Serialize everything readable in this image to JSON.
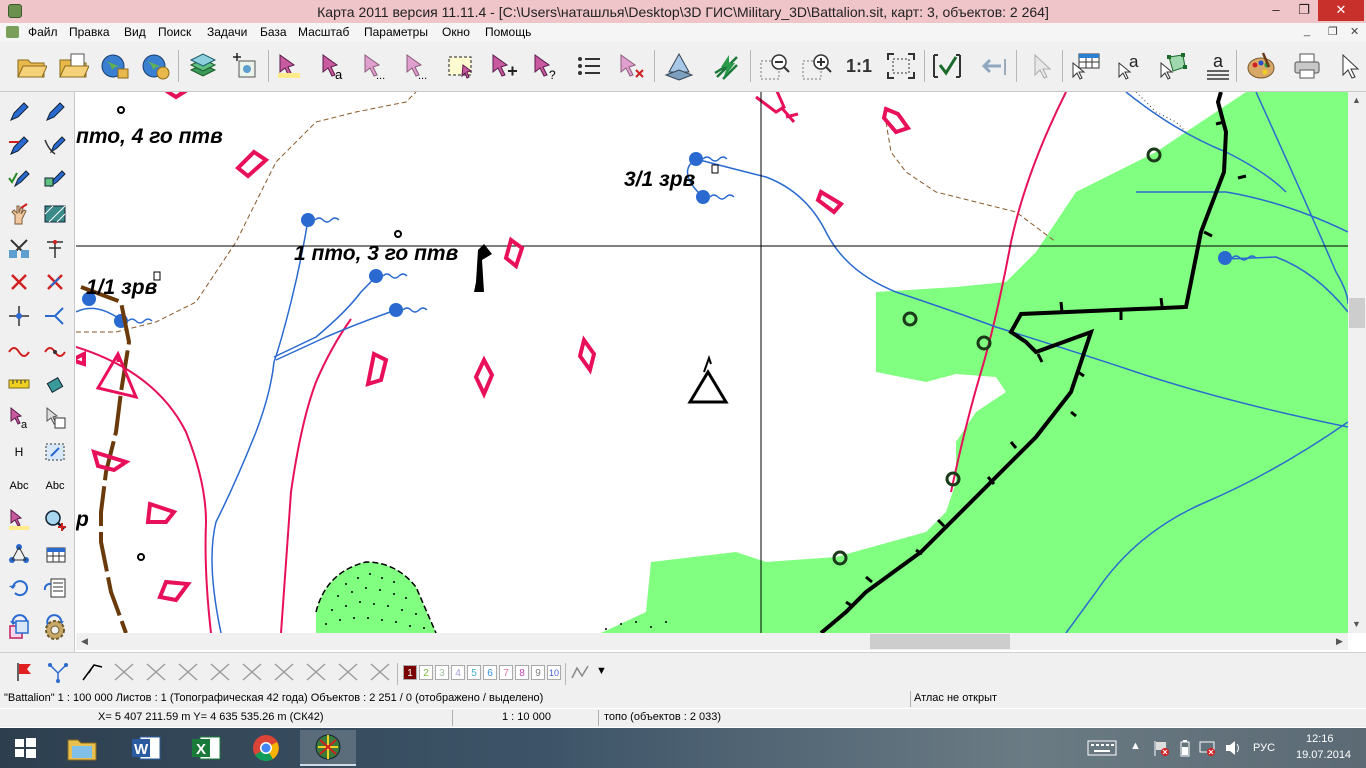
{
  "window": {
    "title": "Карта 2011 версия 11.11.4 - [C:\\Users\\наташлья\\Desktop\\3D ГИС\\Military_3D\\Battalion.sit, карт: 3, объектов: 2 264]",
    "minimize": "–",
    "restore": "❐",
    "close": "✕"
  },
  "menu": {
    "items": [
      "Файл",
      "Правка",
      "Вид",
      "Поиск",
      "Задачи",
      "База",
      "Масштаб",
      "Параметры",
      "Окно",
      "Помощь"
    ],
    "mdi": [
      "_",
      "❐",
      "✕"
    ]
  },
  "toolbar": {
    "scale_button": "1:1",
    "icons": [
      "open-folder-icon",
      "open-folder-2-icon",
      "open-map-icon",
      "open-map-2-icon",
      "layers-icon",
      "add-map-icon",
      "select-object-icon",
      "select-label-icon",
      "select-dots-icon",
      "select-dots-2-icon",
      "select-area-icon",
      "add-object-icon",
      "query-object-icon",
      "list-icon",
      "clear-selection-icon",
      "3d-view-icon",
      "lightning-icon",
      "zoom-out-icon",
      "zoom-in-icon",
      "scale-1-1-icon",
      "fit-all-icon",
      "check-icon",
      "back-icon",
      "pointer-icon",
      "table-icon",
      "text-pointer-icon",
      "polygon-pointer-icon",
      "text-list-icon",
      "palette-icon",
      "printer-icon",
      "arrow-icon"
    ]
  },
  "lefttools": {
    "height_label": "Н",
    "abc1": "Abc",
    "abc2": "Abc"
  },
  "map": {
    "labels": {
      "l1": "пто, 4 го птв",
      "l2": "3/1 зрв",
      "l3": "1 пто, 3 го птв",
      "l4": "1/1 зрв",
      "l5": "р"
    }
  },
  "bottombar": {
    "layers": [
      "1",
      "2",
      "3",
      "4",
      "5",
      "6",
      "7",
      "8",
      "9",
      "10"
    ],
    "layer_colors": [
      "#7a0000",
      "#7fbf3f",
      "#9fbf9f",
      "#9f9fcf",
      "#3fafcf",
      "#2f8fdf",
      "#df6f9f",
      "#bf3fbf",
      "#7f7f7f",
      "#3f5fdf"
    ]
  },
  "status1": {
    "map_info": "\"Battalion\" 1 : 100 000  Листов : 1  (Топографическая 42 года)  Объектов : 2 251 / 0 (отображено / выделено)",
    "atlas": "Атлас не открыт"
  },
  "status2": {
    "coords": "X= 5 407 211.59 m     Y= 4 635 535.26 m  (СК42)",
    "scale": "1 : 10 000",
    "layer": "топо   (объектов : 2 033)"
  },
  "taskbar": {
    "lang": "РУС",
    "time": "12:16",
    "date": "19.07.2014"
  }
}
